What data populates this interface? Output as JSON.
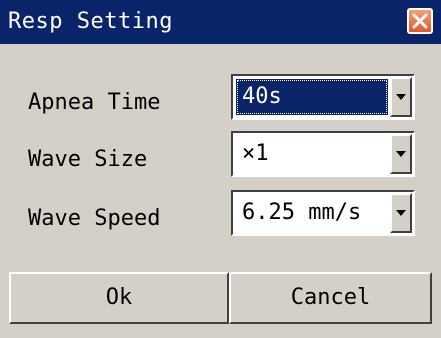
{
  "window": {
    "title": "Resp Setting",
    "close_icon": "close-icon",
    "title_bar_color": "#0a246a"
  },
  "fields": [
    {
      "label": "Apnea Time",
      "value": "40s",
      "selected": true
    },
    {
      "label": "Wave Size",
      "value": "×1",
      "selected": false
    },
    {
      "label": "Wave Speed",
      "value": "6.25 mm/s",
      "selected": false
    }
  ],
  "buttons": {
    "ok_label": "Ok",
    "cancel_label": "Cancel"
  },
  "colors": {
    "dialog_bg": "#d4d0c8",
    "selection": "#0a246a",
    "close_button": "#e0582a"
  }
}
